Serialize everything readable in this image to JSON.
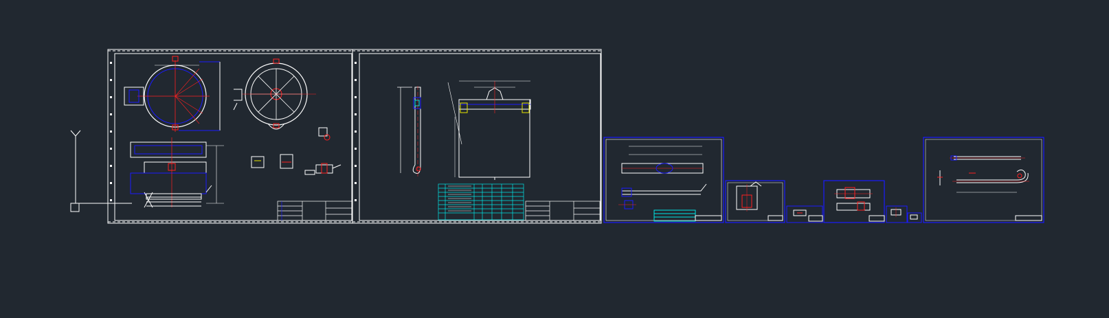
{
  "app": {
    "title": ""
  },
  "colors": {
    "background": "#212830",
    "frame": "#ffffff",
    "blue": "#1a1aff",
    "red": "#ff2020",
    "cyan": "#00e5e5",
    "yellow": "#e6e600",
    "magenta": "#ff30ff",
    "green": "#20ff20"
  },
  "ucs": {
    "y_label": "Y"
  },
  "sheets": [
    {
      "name": "sheet-1-housing-plan",
      "kind": "large-a1"
    },
    {
      "name": "sheet-2-hook-frame",
      "kind": "large-a1"
    },
    {
      "name": "sheet-3-rail-detail",
      "kind": "small"
    },
    {
      "name": "sheet-4-bracket",
      "kind": "small"
    },
    {
      "name": "sheet-5-part",
      "kind": "tiny"
    },
    {
      "name": "sheet-6-clamp",
      "kind": "small"
    },
    {
      "name": "sheet-7-part",
      "kind": "tiny"
    },
    {
      "name": "sheet-8-pin",
      "kind": "tiny"
    },
    {
      "name": "sheet-9-long-rod",
      "kind": "small"
    }
  ]
}
